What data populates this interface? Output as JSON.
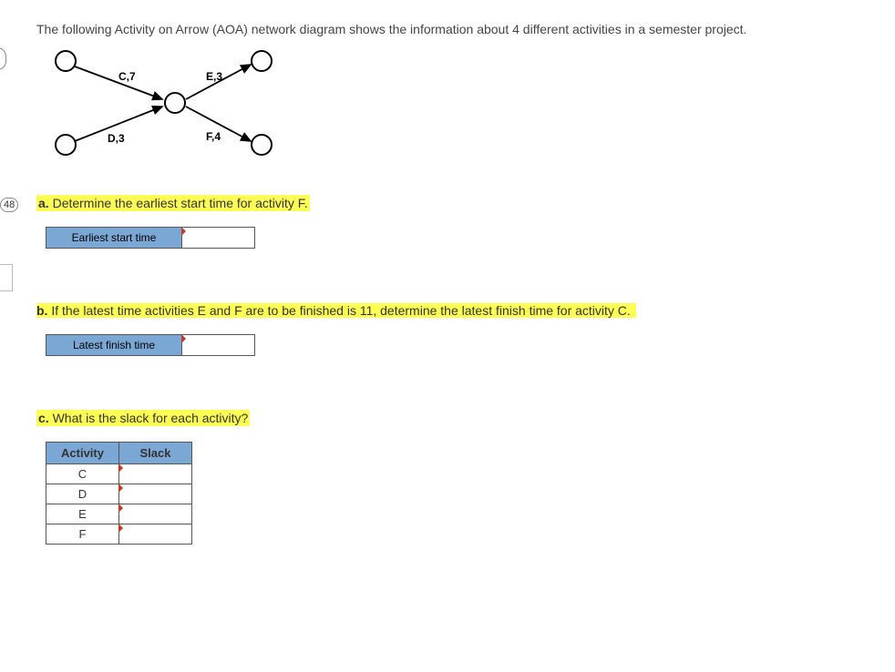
{
  "badge": "48",
  "intro": "The following Activity on Arrow (AOA) network diagram shows the information about 4 different activities in a semester project.",
  "diagram": {
    "edges": {
      "c": "C,7",
      "d": "D,3",
      "e": "E,3",
      "f": "F,4"
    }
  },
  "qa": {
    "prefix": "a.",
    "text": " Determine the earliest start time for activity F.",
    "input_label": "Earliest start time"
  },
  "qb": {
    "prefix": "b.",
    "text": " If the latest time activities E and F are to be finished is 11, determine the latest finish time for activity C.",
    "input_label": "Latest finish time"
  },
  "qc": {
    "prefix": "c.",
    "text": " What is the slack for each activity?",
    "table": {
      "head_activity": "Activity",
      "head_slack": "Slack",
      "rows": [
        "C",
        "D",
        "E",
        "F"
      ]
    }
  }
}
